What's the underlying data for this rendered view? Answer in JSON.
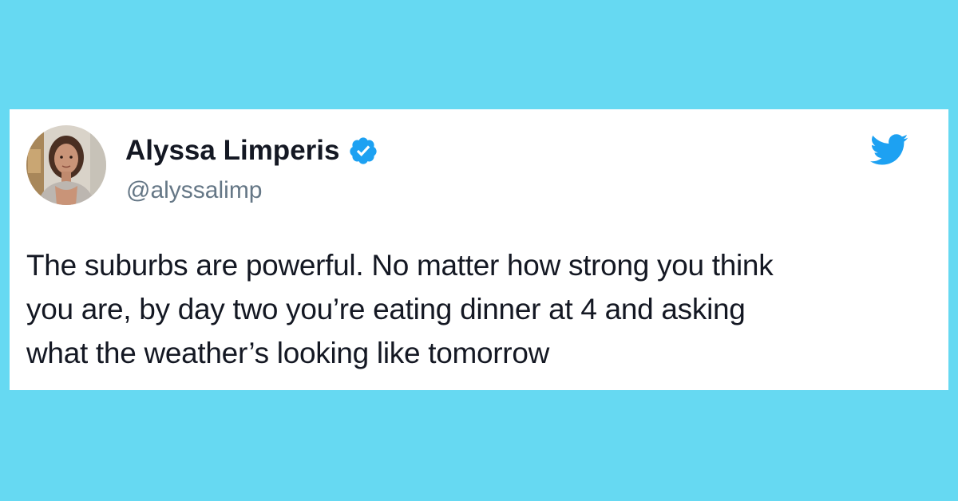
{
  "colors": {
    "background": "#66d9f2",
    "card": "#ffffff",
    "name_text": "#141823",
    "handle_text": "#657786",
    "twitter_blue": "#1da1f2"
  },
  "tweet": {
    "author": {
      "display_name": "Alyssa Limperis",
      "handle": "@alyssalimp",
      "verified": true,
      "avatar_icon": "profile-photo"
    },
    "brand_icon": "twitter-bird-icon",
    "text_lines": [
      "The suburbs are powerful. No matter how strong you think",
      "you are, by day two you’re eating dinner at 4 and asking",
      "what the weather’s looking like tomorrow"
    ]
  }
}
